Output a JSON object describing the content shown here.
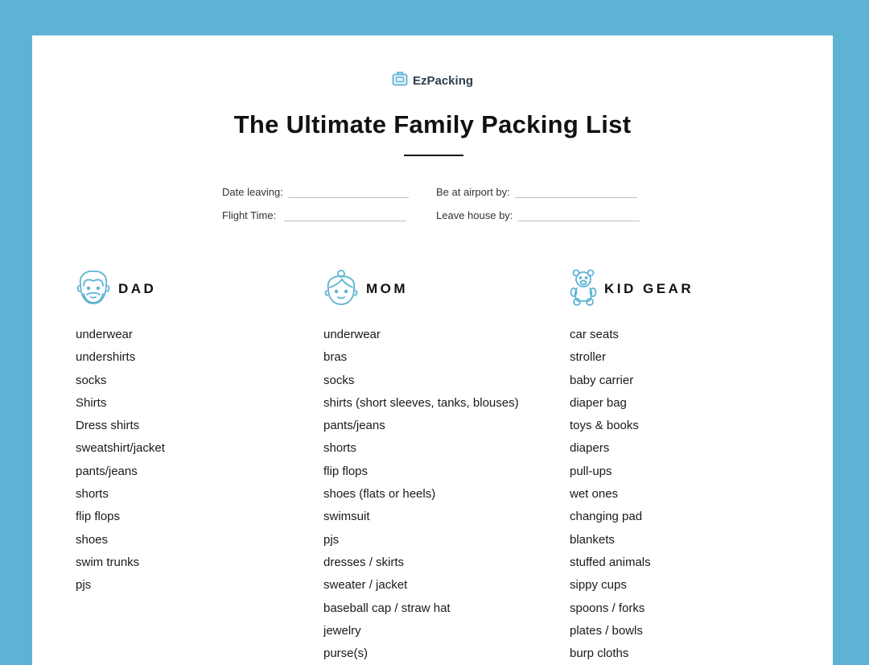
{
  "brand": {
    "name": "EzPacking",
    "icon": "luggage-icon",
    "color": "#5db3d3"
  },
  "title": "The Ultimate Family Packing List",
  "fields": {
    "date_leaving": "Date leaving:",
    "be_at_airport": "Be at airport by:",
    "flight_time": "Flight Time:",
    "leave_house": "Leave house by:"
  },
  "columns": {
    "dad": {
      "label": "DAD",
      "icon": "dad-face-icon",
      "items": [
        "underwear",
        "undershirts",
        "socks",
        "Shirts",
        "Dress shirts",
        "sweatshirt/jacket",
        "pants/jeans",
        "shorts",
        "flip flops",
        "shoes",
        "swim trunks",
        "pjs"
      ]
    },
    "mom": {
      "label": "MOM",
      "icon": "mom-face-icon",
      "items": [
        "underwear",
        "bras",
        "socks",
        "shirts (short sleeves, tanks, blouses)",
        "pants/jeans",
        "shorts",
        "flip flops",
        "shoes (flats or heels)",
        "swimsuit",
        "pjs",
        "dresses / skirts",
        "sweater / jacket",
        "baseball cap / straw hat",
        "jewelry",
        "purse(s)"
      ]
    },
    "kid_gear": {
      "label": "KID GEAR",
      "icon": "teddy-bear-icon",
      "items": [
        "car seats",
        "stroller",
        "baby carrier",
        "diaper bag",
        "toys & books",
        "diapers",
        "pull-ups",
        "wet ones",
        "changing pad",
        "blankets",
        "stuffed animals",
        "sippy cups",
        "spoons / forks",
        "plates / bowls",
        "burp cloths"
      ]
    }
  },
  "colors": {
    "background": "#5db3d3",
    "icon_accent": "#5db3d3",
    "text": "#1a1a1a"
  }
}
